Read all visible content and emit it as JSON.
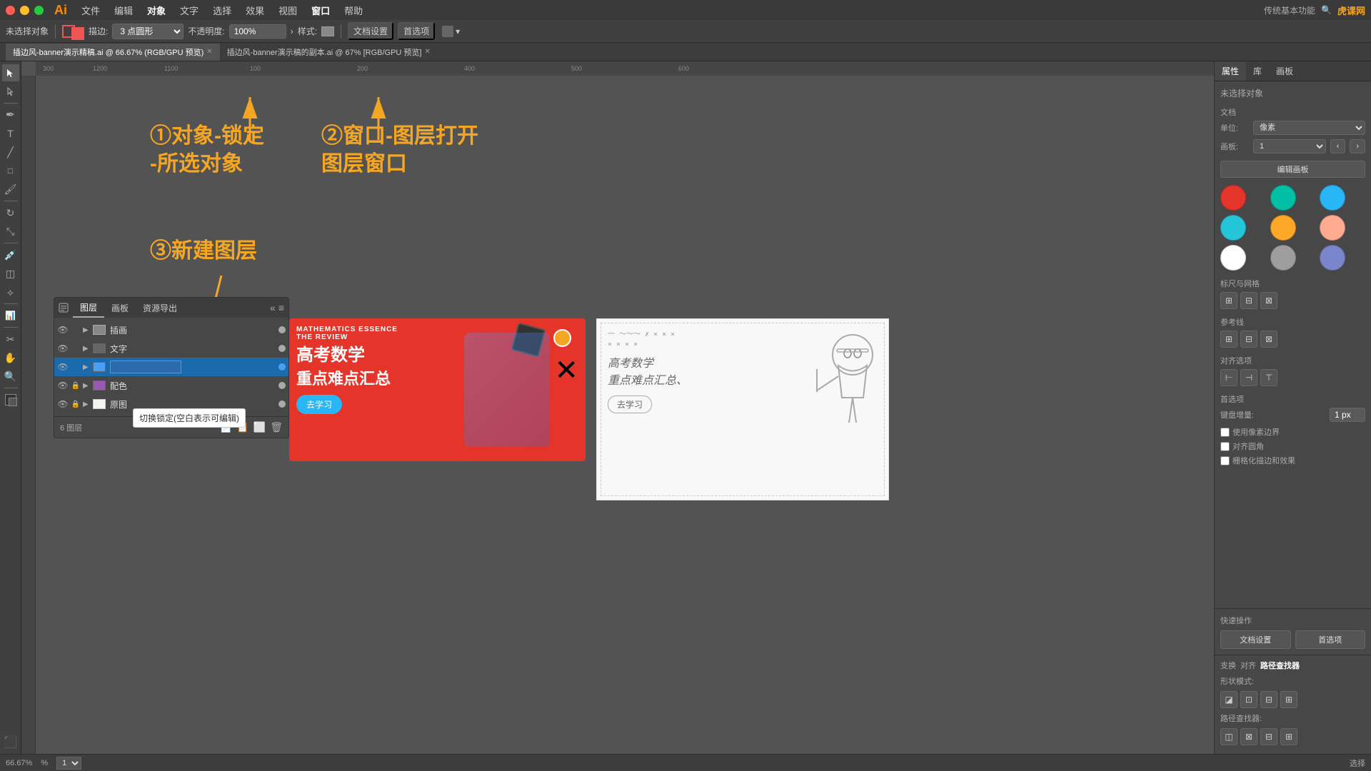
{
  "app": {
    "title": "Ai",
    "name": "Illustrator CC"
  },
  "menubar": {
    "mac_buttons": [
      "close",
      "minimize",
      "maximize"
    ],
    "menus": [
      "文件",
      "编辑",
      "对象",
      "文字",
      "选择",
      "效果",
      "视图",
      "窗口",
      "帮助"
    ],
    "right_text": "传统基本功能",
    "site": "虎课网"
  },
  "toolbar": {
    "unselected_label": "未选择对象",
    "stroke_label": "描边:",
    "stroke_options": [
      "3 点圆形"
    ],
    "opacity_label": "不透明度:",
    "opacity_value": "100%",
    "style_label": "样式:",
    "doc_settings": "文档设置",
    "preferences": "首选项"
  },
  "tabs": [
    {
      "name": "插边风-banner演示精稿.ai",
      "suffix": "@ 66.67% (RGB/GPU 预览)",
      "active": true
    },
    {
      "name": "插边风-banner演示稿的副本.ai",
      "suffix": "@ 67% [RGB/GPU 预览]",
      "active": false
    }
  ],
  "annotations": {
    "anno1": "①对象-锁定\n-所选对象",
    "anno2": "②窗口-图层打开\n图层窗口",
    "anno3": "③新建图层"
  },
  "canvas": {
    "zoom": "66.67%",
    "page": "1",
    "tool": "选择"
  },
  "layers_panel": {
    "tabs": [
      "图层",
      "画板",
      "资源导出"
    ],
    "layers": [
      {
        "name": "插画",
        "visible": true,
        "locked": false,
        "expanded": false,
        "color": "#aaa"
      },
      {
        "name": "文字",
        "visible": true,
        "locked": false,
        "expanded": false,
        "color": "#aaa"
      },
      {
        "name": "",
        "visible": true,
        "locked": false,
        "expanded": false,
        "selected": true,
        "editing": true,
        "color": "#4a9ff5"
      },
      {
        "name": "配色",
        "visible": true,
        "locked": true,
        "expanded": true,
        "color": "#aaa"
      },
      {
        "name": "原图",
        "visible": true,
        "locked": true,
        "expanded": false,
        "color": "#aaa"
      }
    ],
    "footer": {
      "count": "6 图层",
      "buttons": [
        "new_layer",
        "delete_layer",
        "move_up",
        "move_down"
      ]
    },
    "tooltip": "切换锁定(空白表示可编辑)"
  },
  "right_panel": {
    "tabs": [
      "属性",
      "库",
      "画板"
    ],
    "active_tab": "属性",
    "selected_object": "未选择对象",
    "document_section": {
      "label": "文档",
      "unit_label": "单位:",
      "unit_value": "像素",
      "artboard_label": "画板:",
      "artboard_value": "1",
      "edit_artboard_btn": "编辑画板"
    },
    "rulers_grids": {
      "label": "标尺与网格"
    },
    "guides": {
      "label": "参考线"
    },
    "align": {
      "label": "对齐选项"
    },
    "preferences": {
      "label": "首选项",
      "keyboard_increment_label": "键盘增量:",
      "keyboard_increment_value": "1 px",
      "snap_pixel": "使用像素边界",
      "snap_corner": "对齐圆角",
      "rasterize": "栅格化描边和效果"
    },
    "quick_actions": {
      "label": "快速操作",
      "doc_settings_btn": "文档设置",
      "preferences_btn": "首选项"
    },
    "colors": [
      "#e5342a",
      "#00bfa5",
      "#29b6f6",
      "#26c6da",
      "#ffa726",
      "#ffab91",
      "#ffffff",
      "#9e9e9e",
      "#7986cb"
    ]
  },
  "bottom_panel": {
    "tabs": [
      "支换",
      "对齐",
      "路径查找器"
    ],
    "active_tab": "路径查找器",
    "shape_mode_label": "形状模式:",
    "pathfinder_label": "路径查找器:"
  },
  "statusbar": {
    "zoom": "66.67%",
    "artboard": "1",
    "tool": "选择"
  },
  "banner": {
    "tag1": "MATHEMATICS ESSENCE",
    "tag2": "THE REVIEW",
    "title1": "高考数学",
    "title2": "重点难点汇总",
    "cta": "去学习"
  }
}
